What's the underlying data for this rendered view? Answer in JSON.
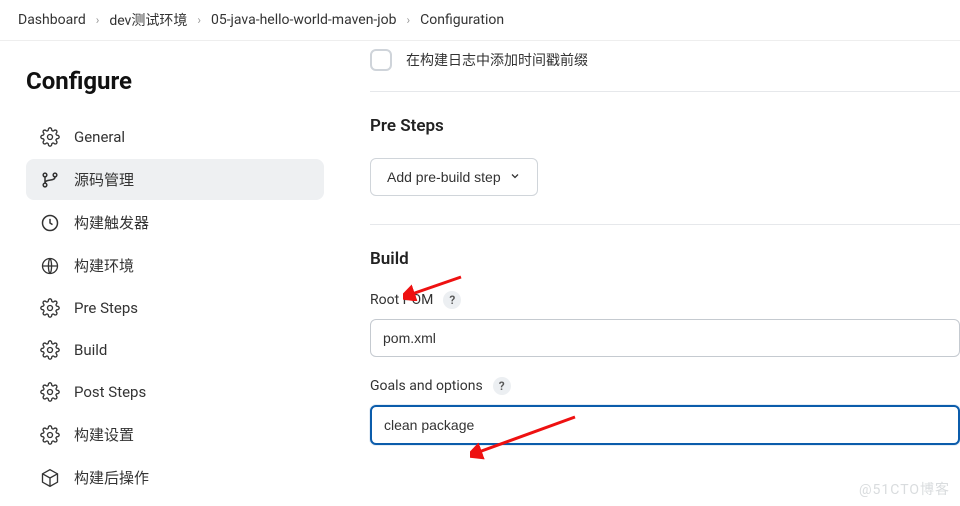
{
  "breadcrumb": {
    "items": [
      "Dashboard",
      "dev测试环境",
      "05-java-hello-world-maven-job",
      "Configuration"
    ]
  },
  "sidebar": {
    "title": "Configure",
    "items": [
      {
        "label": "General"
      },
      {
        "label": "源码管理"
      },
      {
        "label": "构建触发器"
      },
      {
        "label": "构建环境"
      },
      {
        "label": "Pre Steps"
      },
      {
        "label": "Build"
      },
      {
        "label": "Post Steps"
      },
      {
        "label": "构建设置"
      },
      {
        "label": "构建后操作"
      }
    ],
    "activeIndex": 1
  },
  "main": {
    "timestamp_checkbox_label": "在构建日志中添加时间戳前缀",
    "pre_steps": {
      "title": "Pre Steps",
      "add_button": "Add pre-build step"
    },
    "build": {
      "title": "Build",
      "root_pom": {
        "label": "Root POM",
        "value": "pom.xml"
      },
      "goals": {
        "label": "Goals and options",
        "value": "clean package"
      }
    }
  },
  "watermark": "@51CTO博客",
  "help_glyph": "?"
}
